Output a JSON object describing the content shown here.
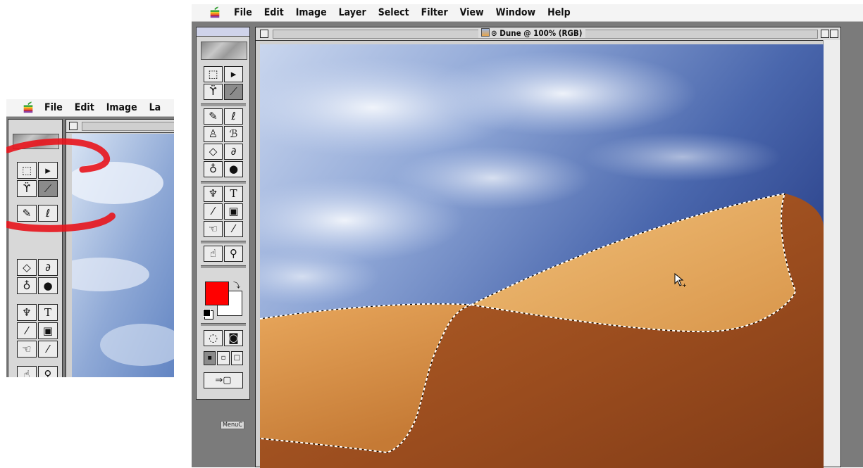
{
  "menu": {
    "items": [
      "File",
      "Edit",
      "Image",
      "Layer",
      "Select",
      "Filter",
      "View",
      "Window",
      "Help"
    ]
  },
  "inset_menu": {
    "items": [
      "File",
      "Edit",
      "Image",
      "La"
    ]
  },
  "document": {
    "title": "Dune @ 100% (RGB)"
  },
  "toolbox": {
    "collapsed_label": "MenuC"
  },
  "colors": {
    "foreground": "#ff0000",
    "background": "#ffffff",
    "highlight_stroke": "#e8141c"
  },
  "icons": [
    "apple-menu-icon",
    "marquee-tool-icon",
    "move-tool-icon",
    "lasso-tool-icon",
    "magic-wand-icon",
    "airbrush-icon",
    "brush-icon",
    "stamp-icon",
    "history-brush-icon",
    "eraser-icon",
    "pencil-icon",
    "blur-icon",
    "burn-icon",
    "pen-icon",
    "type-icon",
    "measure-icon",
    "gradient-icon",
    "hand-tool-icon",
    "eyedropper-icon",
    "zoom-tool-icon",
    "swap-colors-icon",
    "default-colors-icon",
    "quickmask-icon",
    "screen-mode-icon",
    "jump-to-imageready-icon",
    "arrow-cursor-icon"
  ]
}
